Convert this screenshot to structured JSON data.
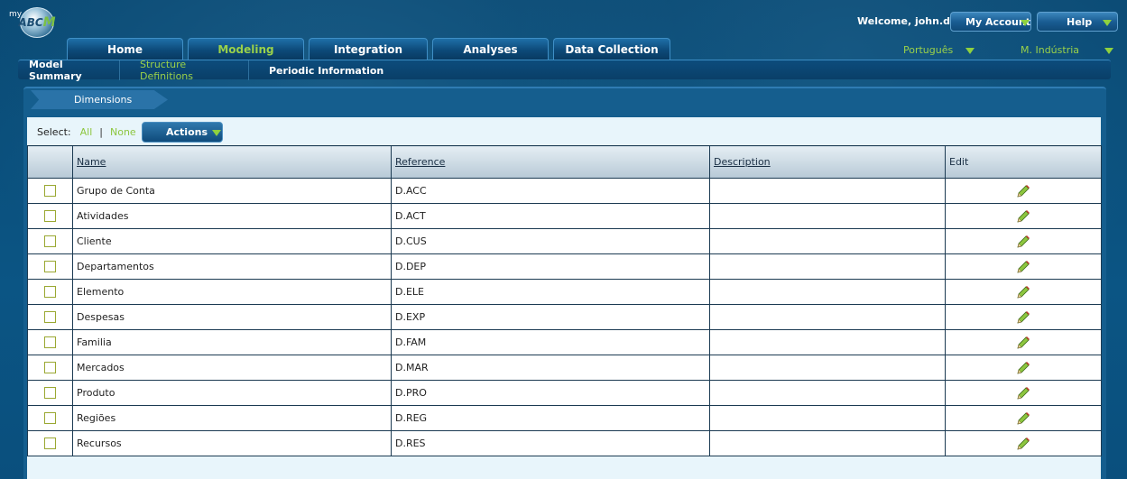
{
  "app": {
    "logo_prefix": "my",
    "logo_text": "ABC",
    "logo_accent": "M"
  },
  "header": {
    "welcome": "Welcome, john.doe",
    "my_account": "My Account",
    "help": "Help",
    "language": "Português",
    "model": "M. Indústria"
  },
  "main_tabs": [
    "Home",
    "Modeling",
    "Integration",
    "Analyses",
    "Data Collection"
  ],
  "sub_nav": [
    "Model Summary",
    "Structure Definitions",
    "Periodic Information"
  ],
  "breadcrumb": "Dimensions",
  "select_bar": {
    "label": "Select:",
    "all": "All",
    "separator": "|",
    "none": "None",
    "actions": "Actions"
  },
  "table": {
    "columns": [
      "Name",
      "Reference",
      "Description",
      "Edit"
    ],
    "rows": [
      {
        "name": "Grupo de Conta",
        "reference": "D.ACC",
        "description": ""
      },
      {
        "name": "Atividades",
        "reference": "D.ACT",
        "description": ""
      },
      {
        "name": "Cliente",
        "reference": "D.CUS",
        "description": ""
      },
      {
        "name": "Departamentos",
        "reference": "D.DEP",
        "description": ""
      },
      {
        "name": "Elemento",
        "reference": "D.ELE",
        "description": ""
      },
      {
        "name": "Despesas",
        "reference": "D.EXP",
        "description": ""
      },
      {
        "name": "Familia",
        "reference": "D.FAM",
        "description": ""
      },
      {
        "name": "Mercados",
        "reference": "D.MAR",
        "description": ""
      },
      {
        "name": "Produto",
        "reference": "D.PRO",
        "description": ""
      },
      {
        "name": "Regiões",
        "reference": "D.REG",
        "description": ""
      },
      {
        "name": "Recursos",
        "reference": "D.RES",
        "description": ""
      }
    ]
  },
  "colors": {
    "accent_green": "#8dc63f",
    "nav_blue": "#0d4a79",
    "panel_bg": "#e8f5fb"
  },
  "icons": {
    "edit": "pencil-icon",
    "dropdown": "chevron-down-icon"
  }
}
